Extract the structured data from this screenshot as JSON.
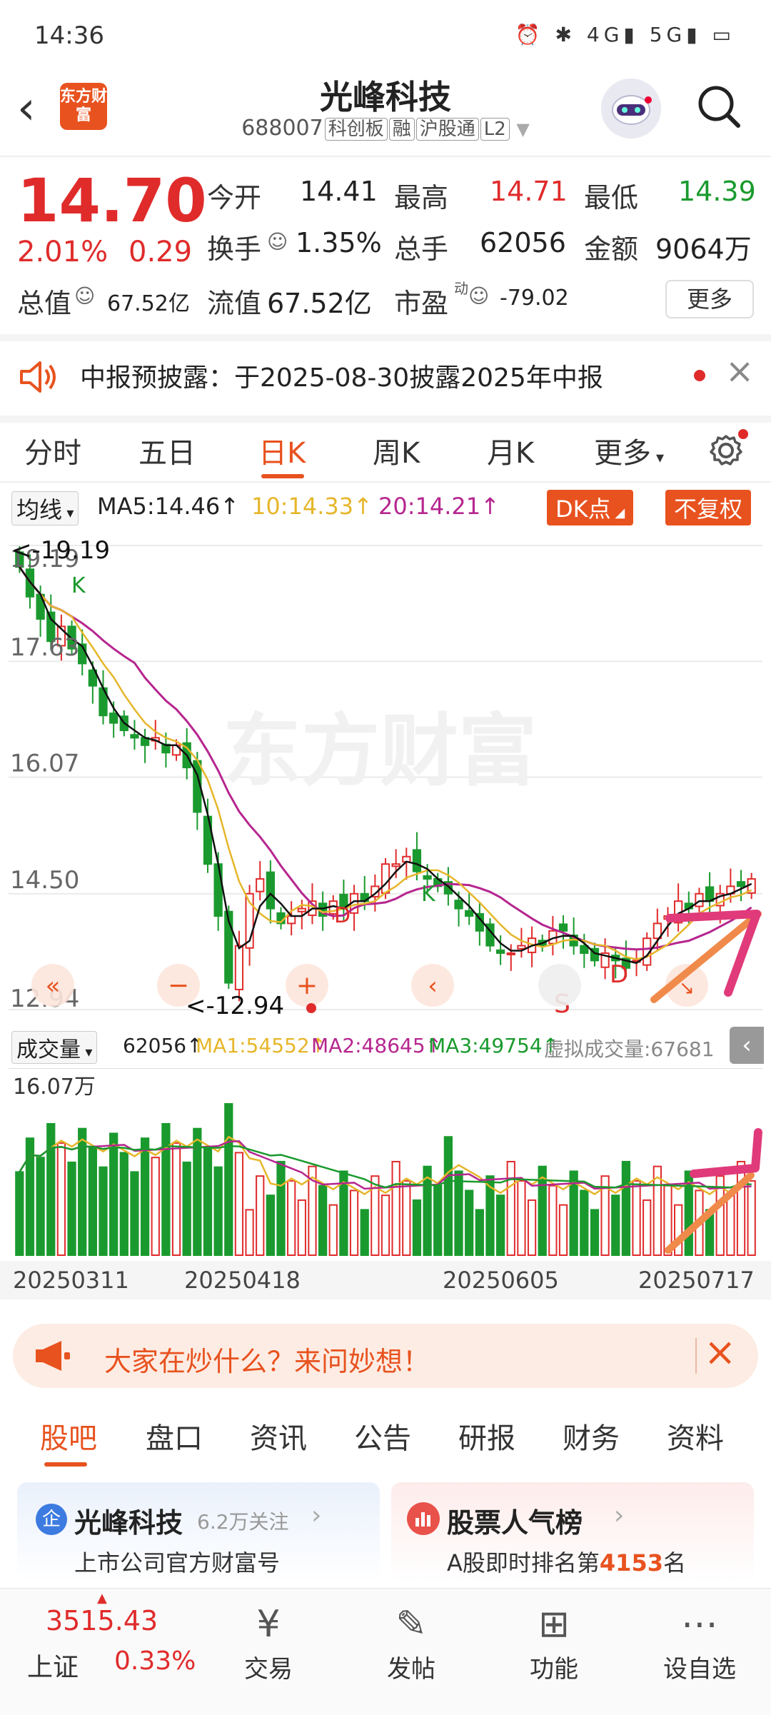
{
  "status_bar": {
    "time": "14:36",
    "icons": "⏰ ✱ 4G▮ 5G▮ ▭"
  },
  "header": {
    "logo_text": "东方财富",
    "title": "光峰科技",
    "code": "688007",
    "tags": [
      "科创板",
      "融",
      "沪股通",
      "L2"
    ]
  },
  "quote": {
    "price": "14.70",
    "pct": "2.01%",
    "change": "0.29",
    "rows": [
      {
        "l1": "今开",
        "v1": "14.41",
        "l2": "最高",
        "v2": "14.71",
        "l3": "最低",
        "v3": "14.39"
      },
      {
        "l1": "换手",
        "v1": "1.35%",
        "l2": "总手",
        "v2": "62056",
        "l3": "金额",
        "v3": "9064万"
      },
      {
        "l1": "总值",
        "v1": "67.52亿",
        "l2": "流值",
        "v2": "67.52亿",
        "l3": "市盈",
        "v3": "-79.02"
      }
    ],
    "pe_superscript": "动",
    "more_button": "更多",
    "colors": {
      "up": "#e02b2b",
      "down": "#1a9a2e",
      "accent": "#e8521f"
    }
  },
  "notice": {
    "text": "中报预披露：于2025-08-30披露2025年中报"
  },
  "chart_tabs": {
    "items": [
      "分时",
      "五日",
      "日K",
      "周K",
      "月K",
      "更多"
    ],
    "active": "日K"
  },
  "ma_bar": {
    "selector": "均线",
    "ma5": "MA5:14.46↑",
    "ma10": "10:14.33↑",
    "ma20": "20:14.21↑",
    "dk_button": "DK点",
    "adjust_button": "不复权"
  },
  "chart_data": {
    "type": "candlestick",
    "price_axis_labels": [
      "19.19",
      "17.63",
      "16.07",
      "14.50",
      "12.94"
    ],
    "ylim": [
      12.94,
      19.19
    ],
    "high_marker": "<-19.19",
    "low_marker": "<-12.94",
    "signal_labels": [
      "K",
      "D",
      "K",
      "S",
      "D"
    ],
    "watermark": "东方财富",
    "close_series": [
      18.9,
      18.5,
      18.2,
      17.9,
      18.1,
      17.8,
      17.6,
      17.3,
      16.9,
      16.8,
      16.7,
      16.6,
      16.5,
      16.6,
      16.4,
      16.5,
      16.2,
      15.6,
      14.9,
      14.2,
      13.3,
      13.8,
      14.5,
      14.7,
      14.3,
      14.1,
      14.2,
      14.3,
      14.4,
      14.2,
      14.4,
      14.3,
      14.5,
      14.4,
      14.6,
      14.9,
      14.9,
      15.0,
      14.8,
      14.7,
      14.6,
      14.5,
      14.3,
      14.2,
      14.0,
      13.8,
      13.7,
      13.7,
      13.8,
      13.9,
      13.8,
      14.0,
      14.0,
      13.8,
      13.7,
      13.6,
      13.7,
      13.6,
      13.5,
      13.6,
      13.9,
      14.1,
      14.2,
      14.4,
      14.3,
      14.5,
      14.4,
      14.5,
      14.6,
      14.6,
      14.7
    ],
    "volume": {
      "label": "成交量",
      "current": "62056↑",
      "ma1": "MA1:54552↑",
      "ma2": "MA2:48645↑",
      "ma3": "MA3:49754↑",
      "virtual": "虚拟成交量:67681",
      "axis_top": "16.07万"
    },
    "dates": [
      "20250311",
      "20250418",
      "20250605",
      "20250717"
    ]
  },
  "promo": {
    "text": "大家在炒什么？来问妙想！"
  },
  "bottom_tabs": {
    "items": [
      "股吧",
      "盘口",
      "资讯",
      "公告",
      "研报",
      "财务",
      "资料"
    ],
    "active": "股吧"
  },
  "cards": {
    "left": {
      "badge": "企",
      "title": "光峰科技",
      "follow": "6.2万关注",
      "subtitle": "上市公司官方财富号"
    },
    "right": {
      "title": "股票人气榜",
      "subtitle_pre": "A股即时排名第",
      "rank": "4153",
      "subtitle_post": "名"
    }
  },
  "bottom_bar": {
    "index_value": "3515.43",
    "index_name": "上证",
    "index_pct": "0.33%",
    "items": [
      {
        "label": "交易",
        "icon": "¥"
      },
      {
        "label": "发帖",
        "icon": "✎"
      },
      {
        "label": "功能",
        "icon": "⊞"
      },
      {
        "label": "设自选",
        "icon": "⋯"
      }
    ]
  }
}
